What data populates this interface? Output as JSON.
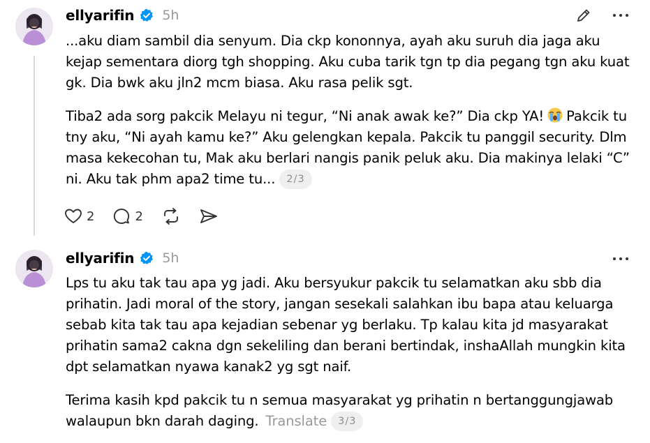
{
  "posts": [
    {
      "username": "ellyarifin",
      "time": "5h",
      "paragraph1": "...aku diam sambil dia senyum. Dia ckp kononnya, ayah aku suruh dia jaga aku kejap sementara diorg tgh shopping. Aku cuba tarik tgn tp dia pegang tgn aku kuat gk. Dia bwk aku jln2 mcm biasa. Aku rasa pelik sgt.",
      "paragraph2_a": "Tiba2 ada sorg pakcik Melayu ni tegur, “Ni anak awak ke?” Dia ckp YA!",
      "paragraph2_b": "Pakcik tu tny aku, “Ni ayah kamu ke?” Aku gelengkan kepala. Pakcik tu panggil security. Dlm masa kekecohan tu, Mak aku berlari nangis panik peluk aku. Dia makinya lelaki “C” ni. Aku tak phm apa2 time tu...",
      "page_indicator": "2/3",
      "likes": "2",
      "replies": "2"
    },
    {
      "username": "ellyarifin",
      "time": "5h",
      "paragraph1": "Lps tu aku tak tau apa yg jadi. Aku bersyukur pakcik tu selamatkan aku sbb dia prihatin. Jadi moral of the story, jangan sesekali salahkan ibu bapa atau keluarga sebab kita tak tau apa kejadian sebenar yg berlaku. Tp kalau kita jd masyarakat prihatin sama2 cakna dgn sekeliling dan berani bertindak, inshaAllah mungkin kita dpt selamatkan nyawa kanak2 yg sgt naif.",
      "paragraph2": "Terima kasih kpd pakcik tu n semua masyarakat yg prihatin n bertanggungjawab walaupun bkn darah daging.",
      "translate_label": "Translate",
      "page_indicator": "3/3"
    }
  ],
  "icons": {
    "edit": "pencil-icon",
    "more": "more-icon",
    "verified": "verified-badge-icon",
    "like": "heart-icon",
    "reply": "comment-icon",
    "repost": "repost-icon",
    "share": "send-icon",
    "emoji": "crying-face-emoji"
  },
  "colors": {
    "verified": "#0095f6",
    "muted": "#999999",
    "pill_bg": "#efefef"
  }
}
